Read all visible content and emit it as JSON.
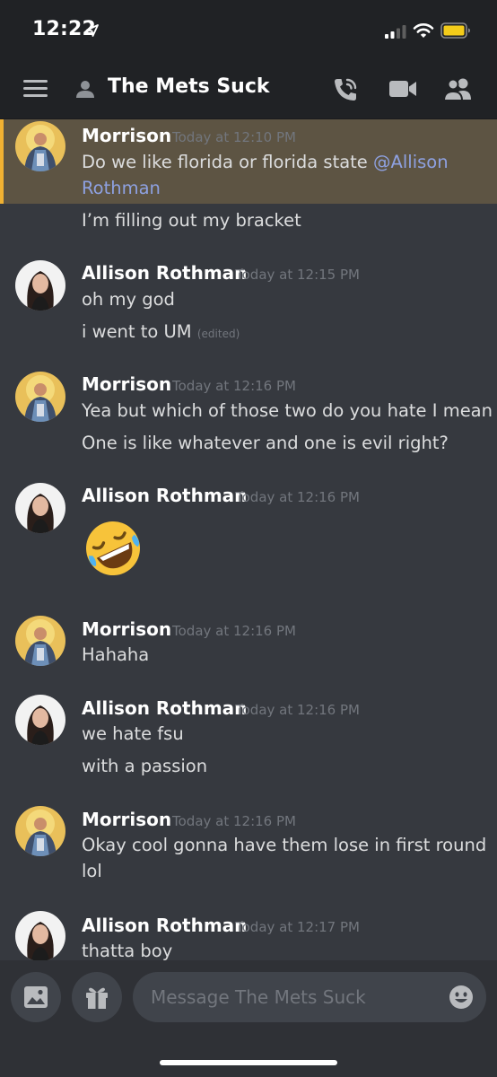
{
  "status_bar": {
    "time": "12:22",
    "location_icon": "location-arrow-icon",
    "signal_icon": "cellular-signal-icon",
    "wifi_icon": "wifi-icon",
    "battery_icon": "battery-icon"
  },
  "header": {
    "title": "The Mets Suck",
    "menu_icon": "hamburger-menu-icon",
    "channel_icon": "user-icon",
    "actions": [
      "phone-call-icon",
      "video-camera-icon",
      "members-icon"
    ]
  },
  "messages": [
    {
      "author": "Morrison",
      "timestamp": "Today at 12:10 PM",
      "highlighted": true,
      "lines": [
        {
          "text": "Do we like florida or florida state ",
          "mention": "@Allison"
        },
        {
          "mention": "Rothman"
        },
        {
          "text": "I’m filling out my bracket"
        }
      ]
    },
    {
      "author": "Allison Rothman",
      "timestamp": "Today at 12:15 PM",
      "lines": [
        {
          "text": "oh my god"
        },
        {
          "text": "i went to UM",
          "edited": "(edited)"
        }
      ]
    },
    {
      "author": "Morrison",
      "timestamp": "Today at 12:16 PM",
      "lines": [
        {
          "text": "Yea but which of those two do you hate I mean"
        },
        {
          "text": "One is like whatever and one is evil right?"
        }
      ]
    },
    {
      "author": "Allison Rothman",
      "timestamp": "Today at 12:16 PM",
      "emoji": "rolling-on-floor-laughing-emoji"
    },
    {
      "author": "Morrison",
      "timestamp": "Today at 12:16 PM",
      "lines": [
        {
          "text": "Hahaha"
        }
      ]
    },
    {
      "author": "Allison Rothman",
      "timestamp": "Today at 12:16 PM",
      "lines": [
        {
          "text": "we hate fsu"
        },
        {
          "text": "with a passion"
        }
      ]
    },
    {
      "author": "Morrison",
      "timestamp": "Today at 12:16 PM",
      "lines": [
        {
          "text": "Okay cool gonna have them lose in first round"
        },
        {
          "text": "lol"
        }
      ]
    },
    {
      "author": "Allison Rothman",
      "timestamp": "Today at 12:17 PM",
      "lines": [
        {
          "text": "thatta boy"
        }
      ]
    }
  ],
  "composer": {
    "placeholder": "Message The Mets Suck",
    "buttons": [
      "image-upload-icon",
      "gift-icon",
      "emoji-picker-icon"
    ]
  },
  "colors": {
    "background": "#36393f",
    "header": "#202225",
    "highlight": "#5d5443",
    "highlight_bar": "#f0b132",
    "mention": "#8ea1e1",
    "text": "#dcddde",
    "muted": "#72767d",
    "input": "#40444b"
  }
}
